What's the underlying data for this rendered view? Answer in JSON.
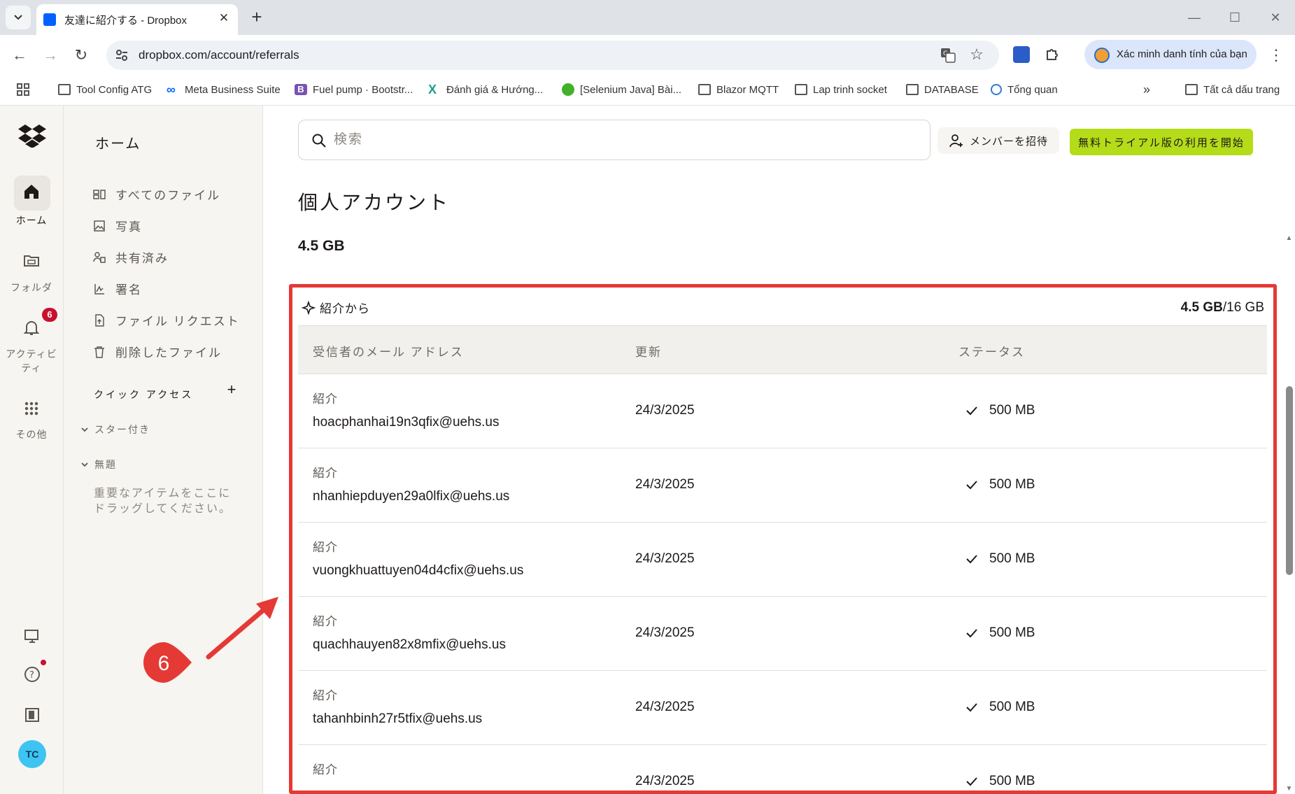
{
  "browser": {
    "tab_title": "友達に紹介する - Dropbox",
    "url": "dropbox.com/account/referrals",
    "profile_chip": "Xác minh danh tính của bạn",
    "bookmarks": [
      {
        "label": "Tool Config ATG",
        "icon": "folder-icon"
      },
      {
        "label": "Meta Business Suite",
        "icon": "meta-icon"
      },
      {
        "label": "Fuel pump · Bootstr...",
        "icon": "bootstrap-icon"
      },
      {
        "label": "Đánh giá & Hướng...",
        "icon": "x-logo-icon"
      },
      {
        "label": "[Selenium Java] Bài...",
        "icon": "selenium-icon"
      },
      {
        "label": "Blazor MQTT",
        "icon": "folder-icon"
      },
      {
        "label": "Lap trinh socket",
        "icon": "folder-icon"
      },
      {
        "label": "DATABASE",
        "icon": "folder-icon"
      },
      {
        "label": "Tổng quan",
        "icon": "globe-icon"
      }
    ],
    "all_bookmarks": "Tất cả dấu trang",
    "overflow": "»"
  },
  "rail": {
    "home": "ホーム",
    "folders": "フォルダ",
    "activity": "アクティビティ",
    "activity_badge": "6",
    "more": "その他",
    "avatar": "TC"
  },
  "nav": {
    "title": "ホーム",
    "items": [
      {
        "label": "すべてのファイル",
        "icon": "files-icon"
      },
      {
        "label": "写真",
        "icon": "photo-icon"
      },
      {
        "label": "共有済み",
        "icon": "shared-icon"
      },
      {
        "label": "署名",
        "icon": "signature-icon"
      },
      {
        "label": "ファイル リクエスト",
        "icon": "file-request-icon"
      },
      {
        "label": "削除したファイル",
        "icon": "trash-icon"
      }
    ],
    "quick_access": "クイック アクセス",
    "starred": "スター付き",
    "untitled": "無題",
    "hint": "重要なアイテムをここにドラッグしてください。"
  },
  "header": {
    "search_placeholder": "検索",
    "invite": "メンバーを招待",
    "trial": "無料トライアル版の利用を開始"
  },
  "main": {
    "title": "個人アカウント",
    "total": "4.5 GB",
    "card_label": "紹介から",
    "card_used": "4.5 GB",
    "card_limit": "/16 GB",
    "columns": [
      "受信者のメール アドレス",
      "更新",
      "ステータス"
    ],
    "rows": [
      {
        "type": "紹介",
        "email": "hoacphanhai19n3qfix@uehs.us",
        "date": "24/3/2025",
        "status": "500 MB"
      },
      {
        "type": "紹介",
        "email": "nhanhiepduyen29a0lfix@uehs.us",
        "date": "24/3/2025",
        "status": "500 MB"
      },
      {
        "type": "紹介",
        "email": "vuongkhuattuyen04d4cfix@uehs.us",
        "date": "24/3/2025",
        "status": "500 MB"
      },
      {
        "type": "紹介",
        "email": "quachhauyen82x8mfix@uehs.us",
        "date": "24/3/2025",
        "status": "500 MB"
      },
      {
        "type": "紹介",
        "email": "tahanhbinh27r5tfix@uehs.us",
        "date": "24/3/2025",
        "status": "500 MB"
      },
      {
        "type": "紹介",
        "email": "",
        "date": "24/3/2025",
        "status": "500 MB"
      }
    ]
  },
  "annotation": {
    "step": "6",
    "color": "#e53935"
  },
  "colors": {
    "accent_green": "#b4dc19",
    "dropbox_blue": "#0061fe",
    "highlight_red": "#e53935"
  }
}
